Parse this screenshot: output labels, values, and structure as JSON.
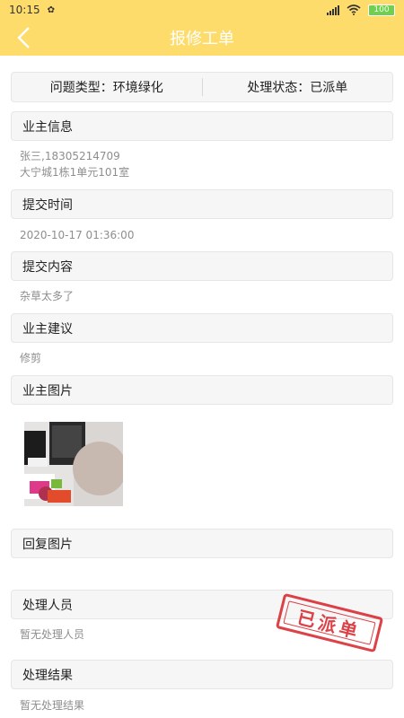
{
  "status_bar": {
    "time": "10:15",
    "battery": "100"
  },
  "nav": {
    "title": "报修工单"
  },
  "summary": {
    "problem_type": "问题类型：环境绿化",
    "process_status": "处理状态：已派单"
  },
  "sections": {
    "owner_info": {
      "title": "业主信息",
      "name_phone": "张三,18305214709",
      "address": "大宁城1栋1单元101室"
    },
    "submit_time": {
      "title": "提交时间",
      "value": "2020-10-17 01:36:00"
    },
    "submit_content": {
      "title": "提交内容",
      "value": "杂草太多了"
    },
    "owner_suggestion": {
      "title": "业主建议",
      "value": "修剪"
    },
    "owner_images": {
      "title": "业主图片"
    },
    "reply_images": {
      "title": "回复图片"
    },
    "handler": {
      "title": "处理人员",
      "value": "暂无处理人员"
    },
    "result": {
      "title": "处理结果",
      "value": "暂无处理结果"
    }
  },
  "stamp": {
    "text": "已派单"
  },
  "colors": {
    "header_bg": "#FEDC6C",
    "stamp_red": "#D8282F"
  }
}
